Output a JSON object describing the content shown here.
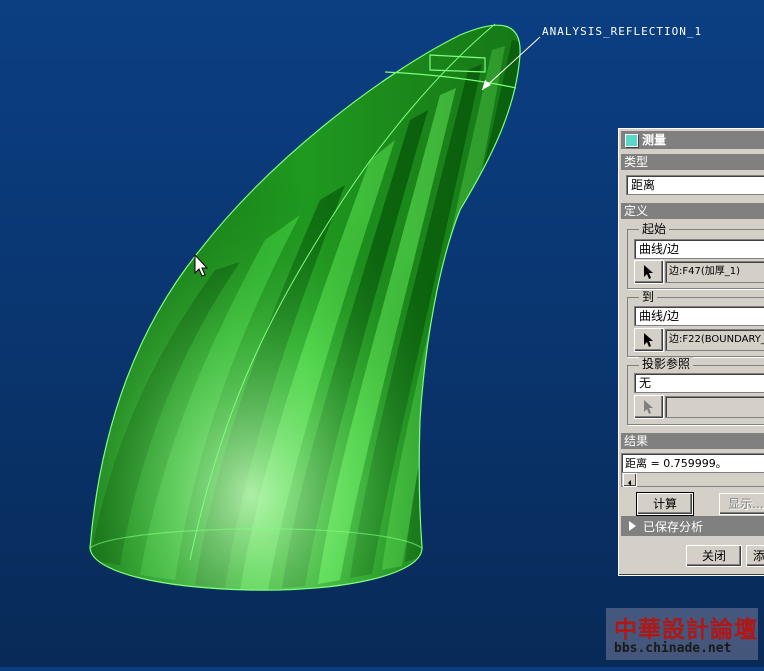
{
  "viewport": {
    "annotation_label": "ANALYSIS_REFLECTION_1",
    "colors": {
      "background_top": "#0b3f82",
      "model_green": "#22b022",
      "model_light": "#7af07a",
      "edge": "#7dff7d"
    }
  },
  "dialog": {
    "title": "测量",
    "type_section": {
      "label": "类型",
      "value": "距离"
    },
    "definition_section": {
      "label": "定义",
      "from_group": {
        "label": "起始",
        "entity_type": "曲线/边",
        "reference": "边:F47(加厚_1)"
      },
      "to_group": {
        "label": "到",
        "entity_type": "曲线/边",
        "reference": "边:F22(BOUNDARY_"
      },
      "projection_group": {
        "label": "投影参照",
        "value": "无",
        "reference": ""
      }
    },
    "result_section": {
      "label": "结果",
      "text": "距离 = 0.759999。"
    },
    "buttons": {
      "compute": "计算",
      "display": "显示...",
      "close": "关闭",
      "add": "添"
    },
    "saved_analysis_label": "已保存分析"
  },
  "watermark": {
    "title": "中華設計論壇",
    "url": "bbs.chinade.net"
  }
}
